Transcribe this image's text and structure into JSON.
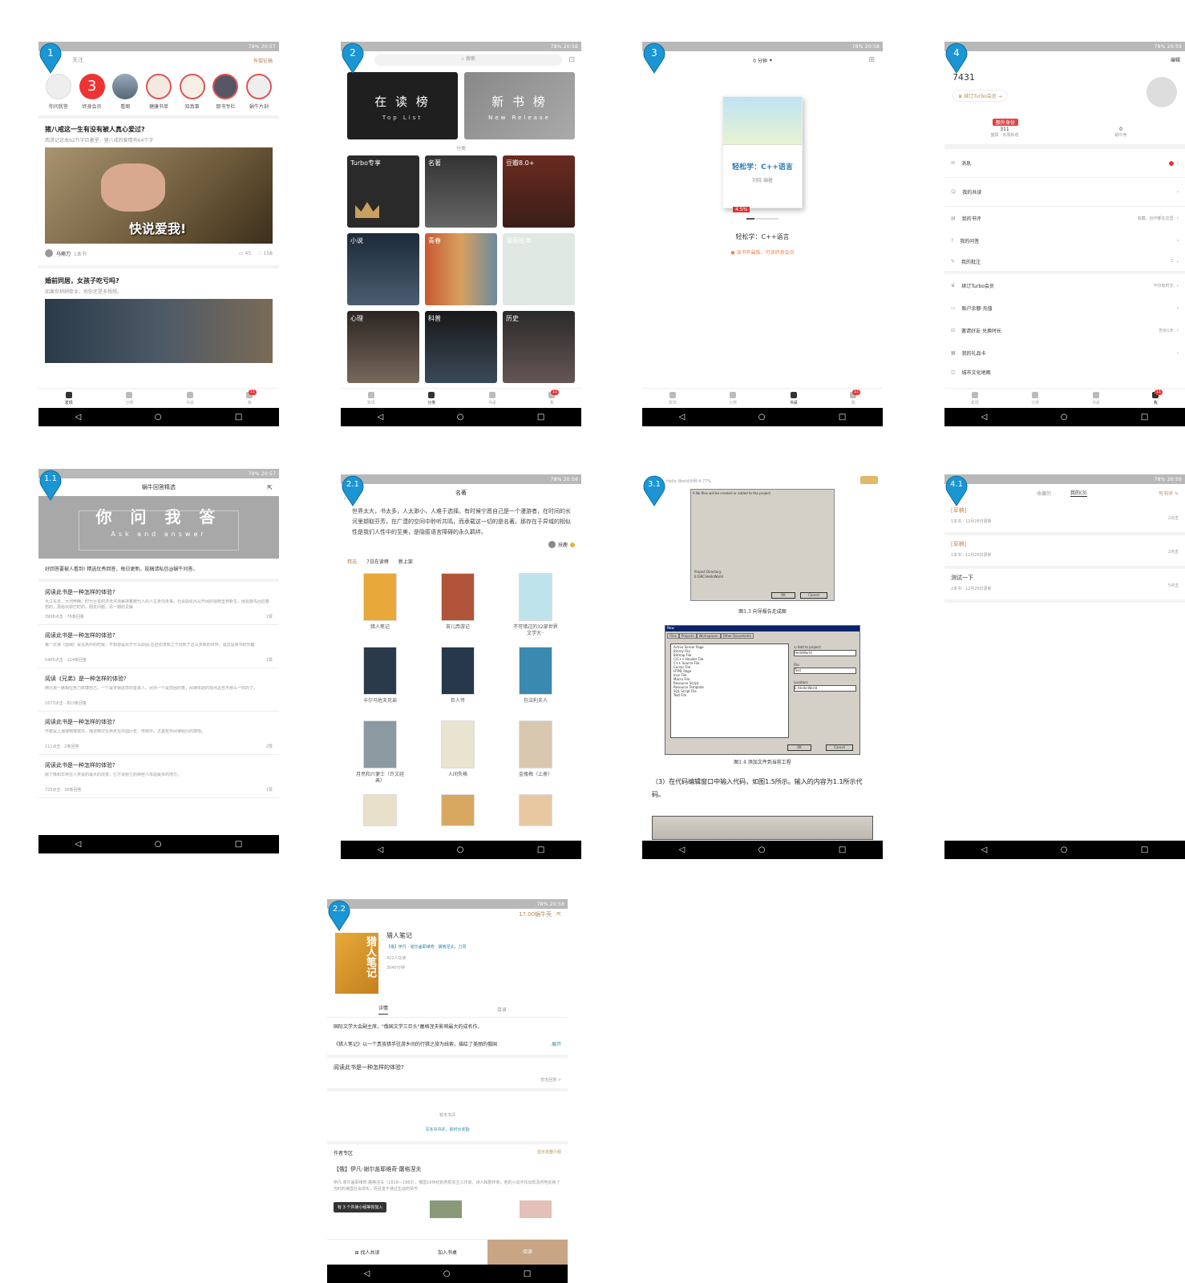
{
  "status": {
    "s1": "79% 20:57",
    "s2": "78% 20:58",
    "s3": "78% 20:58",
    "s4": "78% 20:59",
    "s11": "79% 20:57",
    "s21": "78% 20:58",
    "s41": "78% 20:59",
    "s22": "78% 20:58"
  },
  "pins": [
    "1",
    "2",
    "3",
    "4",
    "1.1",
    "2.1",
    "3.1",
    "4.1",
    "2.2"
  ],
  "nav": {
    "back": "◁",
    "home": "○",
    "recent": "□"
  },
  "tabs": {
    "t1": "发现",
    "t2": "分类",
    "t3": "书桌",
    "t4": "我",
    "badge": "11"
  },
  "p1": {
    "tab_follow": "关注",
    "right_link": "有偿征稿",
    "circles": [
      {
        "label": "你问我答"
      },
      {
        "label": "终身会员",
        "num": "3"
      },
      {
        "label": "看图"
      },
      {
        "label": "健康书单"
      },
      {
        "label": "知真事"
      },
      {
        "label": "那书专栏"
      },
      {
        "label": "蜗牛片刻"
      }
    ],
    "post1": {
      "title": "猪八戒这一生有没有被人真心爱过?",
      "sub": "西游记这本62万字巨著里，猪八戒的爱情有64个字",
      "img_text": "快说爱我!",
      "author": "马嘶刀",
      "author_meta": "1本书",
      "comments": "45",
      "likes": "158"
    },
    "post2": {
      "title": "婚前同居，女孩子吃亏吗?",
      "sub": "如果你稍稍牵业，劝你还是多想想。"
    }
  },
  "p2": {
    "search": "搜索",
    "banner1_cn": "在 读 榜",
    "banner1_en": "Top List",
    "banner2_cn": "新 书 榜",
    "banner2_en": "New Release",
    "section": "分类",
    "cats": [
      "Turbo专享",
      "名著",
      "豆瓣8.0+",
      "小说",
      "青春",
      "漫画绘本",
      "心理",
      "科普",
      "历史"
    ]
  },
  "p3": {
    "time": "0 分钟",
    "book_title": "轻松学：C++语言",
    "cover_title": "轻松学：C++语言",
    "cover_author": "刘晓 编著",
    "progress": "4.5%",
    "notice": "该书年最版，可读终身会员"
  },
  "p4": {
    "edit": "编辑",
    "uid": "7431",
    "turbo": "续订Turbo会员 →",
    "member_tag": "额外身份",
    "stat1": "311",
    "stat1_label": "猫屎 · 本周新增",
    "stat2": "0",
    "stat2_label": "蜗牛壳",
    "menu": [
      {
        "label": "消息",
        "right": ""
      },
      {
        "label": "我的共读",
        "right": ""
      },
      {
        "label": "我的书评",
        "right": "收藏、创作都在这里"
      },
      {
        "label": "我的问答",
        "right": ""
      },
      {
        "label": "我的批注",
        "right": "1"
      },
      {
        "label": "续订Turbo会员",
        "right": "不仅有时长"
      },
      {
        "label": "账户余额·充值",
        "right": ""
      },
      {
        "label": "邀请好友·兑换时长",
        "right": "告诉1天"
      },
      {
        "label": "我的礼品卡",
        "right": ""
      },
      {
        "label": "城市文化地图",
        "right": ""
      }
    ]
  },
  "p11": {
    "title": "蜗牛回答精选",
    "banner_cn": "你 问 我 答",
    "banner_en": "Ask and answer",
    "intro": "好回答要被人看到! 精选优秀回答，每日更新。投稿请私信@蜗牛问答。",
    "qs": [
      {
        "t": "阅读此书是一种怎样的体验?",
        "b": "大江东去，大河奔腾。时代巨变的洪天洪流裹挟着数代人的人生走向未来。社会舆论风从开阔的视野里到新生，朋友群先回应着想的，再给出现已时的。朋友问题，另一期的见解",
        "m": "3908点击 · 76条回答",
        "n": "1赞"
      },
      {
        "t": "阅读此书是一种怎样的体验?",
        "b": "第一次读《围城》是在高中的时候，不知道是出于什么原因,在迫切求知之下找到了这么多新的世界，谈这是读书的乐趣",
        "m": "5465点击 · 114条回答",
        "n": "1赞"
      },
      {
        "t": "阅读《兄弟》是一种怎样的体验?",
        "b": "两兄弟一路相在努力拼搏自己。一个是宋钢这样的善良人，另外一个是穷困的着，阅读体验的观点这也不那么一样的了。",
        "m": "1673点击 · 823条回答",
        "n": ""
      },
      {
        "t": "阅读此书是一种怎样的体验?",
        "b": "作者是上海博物馆馆员，描述两次生命走在中国历史、传统中。尤其有对阅读经历的感悟。",
        "m": "111点击 · 2条回答",
        "n": "2赞"
      },
      {
        "t": "阅读此书是一种怎样的体验?",
        "b": "除了像和日常在人类说的最大的改变。它才会给它的那些人体验最多的地方。",
        "m": "725点击 · 36条回答",
        "n": "1赞"
      }
    ]
  },
  "p21": {
    "title": "名著",
    "quote": "世界太大，书太多，人太渺小，人难于选择。有时候宁愿自己是一个漫游者，在时间的长河里撷取芬芳，在广漠的空间中聆听共鸣，而承载这一切的是名著。那存在于异域的相似性是我们人性中的至美，是隐匿语言障碍的永久羁绊。",
    "signer": "扶鹿",
    "tabs": [
      "精选",
      "7日在读榜",
      "新上架"
    ],
    "books": [
      {
        "t": "猎人笔记"
      },
      {
        "t": "苔儿西游记"
      },
      {
        "t": "不可错过的32部世界文学大··"
      },
      {
        "t": "卡尔马佐夫兄弟"
      },
      {
        "t": "巨人传"
      },
      {
        "t": "包法利夫人"
      },
      {
        "t": "月亮和六便士（许文经典）"
      },
      {
        "t": "人间失格"
      },
      {
        "t": "金瓶梅（上册）"
      }
    ]
  },
  "p31": {
    "top": "Hello World示例 4.77%",
    "note": "A No files will be created or added to the project.",
    "projdir": "Project Directory:",
    "projpath": "E:\\SRC\\HelloWorld",
    "ok": "OK",
    "cancel": "Cancel",
    "fig13": "图1.3 向导报告走成图",
    "fig14": "图1.4 添加文件到当前工程",
    "dlg_title": "New",
    "dlg_tabs": [
      "Files",
      "Projects",
      "Workspaces",
      "Other Documents"
    ],
    "files": [
      "Active Server Page",
      "Binary File",
      "Bitmap File",
      "C/C++ Header File",
      "C++ Source File",
      "Cursor File",
      "HTML Page",
      "Icon File",
      "Macro File",
      "Resource Script",
      "Resource Template",
      "SQL Script File",
      "Text File"
    ],
    "add_proj": "Add to project:",
    "proj": "HelloWorld",
    "file_label": "File",
    "file_val": "Text",
    "loc_label": "Location:",
    "loc_val": "E:\\Hello\\World",
    "para": "（3）在代码编辑窗口中输入代码，如图1.5所示。输入的内容为1.1所示代码。"
  },
  "p41": {
    "tab1": "收藏的",
    "tab2": "我的(3)",
    "write": "写书评",
    "items": [
      {
        "t": "[草稿]",
        "m": "1本书 · 12月26日更新",
        "r": "2点击"
      },
      {
        "t": "[草稿]",
        "m": "1本书 · 12月26日更新",
        "r": "2点击"
      },
      {
        "t": "测试一下",
        "m": "2本书 · 12月26日更新",
        "r": "5点击"
      }
    ]
  },
  "p22": {
    "price": "17.00蜗牛壳",
    "title": "猎人笔记",
    "author": "【俄】伊凡 · 谢尔盖耶维奇 · 屠格涅夫，力冈",
    "meta1": "422人在读",
    "meta2": "3040分钟",
    "tab_detail": "详情",
    "tab_toc": "目录",
    "desc1": "国际文学大会副主席，\"俄国文学三巨头\"屠格涅夫影响最大的成名作。",
    "desc2": "《猎人笔记》以一个贵族猎手驻游乡间的行猎之旅为线索，描绘了美丽的俄国",
    "expand": "展开",
    "q": "阅读此书是一种怎样的体验?",
    "write_ans": "暂无回答 >",
    "no_review": "暂无书评",
    "write_review": "写本书书评，获时长奖励",
    "author_zone": "作者专区",
    "author_more": "显示完整介绍",
    "author_name": "【俄】伊凡·谢尔盖耶维奇·屠格涅夫",
    "author_bio": "伊凡·谢尔盖耶维奇·屠格涅夫（1818—1883），俄国19世纪批判现实主义作家，诗人和剧作家，他的小说不仅出现及时地反映了当时的俄国社会现实，而且善于通过生动的情节",
    "group": "有 3 个共读小组等你加入",
    "btn1": "找人共读",
    "btn2": "加入书桌",
    "btn3": "阅读"
  }
}
